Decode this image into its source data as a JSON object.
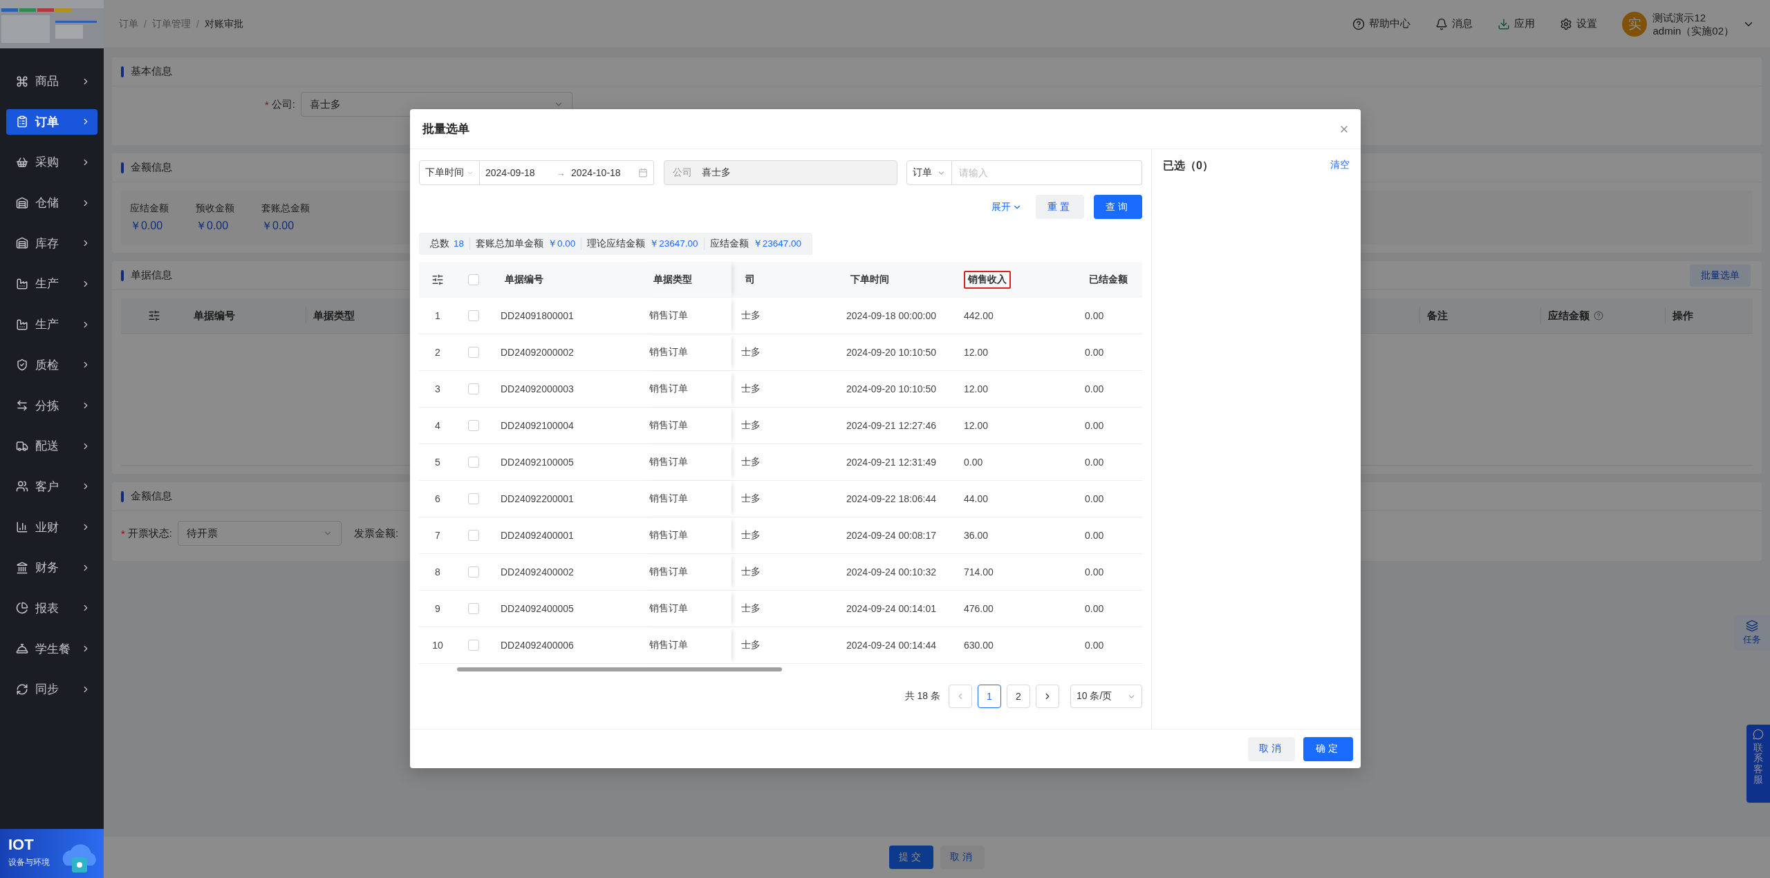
{
  "sidebar": {
    "items": [
      {
        "label": "商品",
        "selected": false
      },
      {
        "label": "订单",
        "selected": true
      },
      {
        "label": "采购",
        "selected": false
      },
      {
        "label": "仓储",
        "selected": false
      },
      {
        "label": "库存",
        "selected": false
      },
      {
        "label": "生产",
        "selected": false
      },
      {
        "label": "生产",
        "selected": false
      },
      {
        "label": "质检",
        "selected": false
      },
      {
        "label": "分拣",
        "selected": false
      },
      {
        "label": "配送",
        "selected": false
      },
      {
        "label": "客户",
        "selected": false
      },
      {
        "label": "业财",
        "selected": false
      },
      {
        "label": "财务",
        "selected": false
      },
      {
        "label": "报表",
        "selected": false
      },
      {
        "label": "学生餐",
        "selected": false
      },
      {
        "label": "同步",
        "selected": false
      }
    ],
    "banner": {
      "title": "IOT",
      "subtitle": "设备与环境"
    }
  },
  "header": {
    "breadcrumb": [
      "订单",
      "订单管理",
      "对账审批"
    ],
    "separator": "/",
    "actions": [
      "帮助中心",
      "消息",
      "应用",
      "设置"
    ],
    "user": {
      "avatar": "实",
      "name": "测试演示12",
      "role": "admin（实施02）"
    }
  },
  "page": {
    "basic": {
      "title": "基本信息",
      "field": {
        "mark": "*",
        "label": "公司:",
        "value": "喜士多"
      }
    },
    "amounts": {
      "title": "金额信息",
      "items": [
        {
          "label": "应结金额",
          "value": "￥0.00"
        },
        {
          "label": "预收金额",
          "value": "￥0.00"
        },
        {
          "label": "套账总金额",
          "value": "￥0.00"
        }
      ]
    },
    "documents": {
      "title": "单据信息",
      "batch_button": "批量选单",
      "columns": [
        {
          "label": "单据编号",
          "info": false
        },
        {
          "label": "单据类型",
          "info": false
        },
        {
          "label": "备注",
          "info": false
        },
        {
          "label": "应结金额",
          "info": true
        },
        {
          "label": "操作",
          "info": false
        }
      ]
    },
    "invoice": {
      "title": "金额信息",
      "field": {
        "mark": "*",
        "label": "开票状态:",
        "value": "待开票"
      },
      "amount_label": "发票金额:"
    },
    "footer_buttons": [
      {
        "label": "提交",
        "kind": "primary"
      },
      {
        "label": "取消",
        "kind": "secondary"
      }
    ]
  },
  "floating": {
    "tasks": "任务",
    "support": "联系客服"
  },
  "modal": {
    "title": "批量选单",
    "filters": {
      "date_field": "下单时间",
      "date_start": "2024-09-18",
      "date_sep": "→",
      "date_end": "2024-10-18",
      "company_label": "公司",
      "company_value": "喜士多",
      "search_type": "订单",
      "search_placeholder": "请输入",
      "expand": "展开",
      "reset": "重置",
      "query": "查询"
    },
    "summary": [
      {
        "label": "总数",
        "value": "18"
      },
      {
        "label": "套账总加单金额",
        "value": "￥0.00"
      },
      {
        "label": "理论应结金额",
        "value": "￥23647.00"
      },
      {
        "label": "应结金额",
        "value": "￥23647.00"
      }
    ],
    "table": {
      "all_checked": false,
      "columns": [
        {
          "label": "单据编号",
          "highlighted": false
        },
        {
          "label": "单据类型",
          "highlighted": false
        },
        {
          "label": "司",
          "highlighted": false
        },
        {
          "label": "下单时间",
          "highlighted": false
        },
        {
          "label": "销售收入",
          "highlighted": true
        },
        {
          "label": "已结金额",
          "highlighted": false
        }
      ],
      "rows": [
        {
          "index": "1",
          "checked": false,
          "number": "DD24091800001",
          "type": "销售订单",
          "company": "士多",
          "time": "2024-09-18 00:00:00",
          "revenue": "442.00",
          "settled": "0.00"
        },
        {
          "index": "2",
          "checked": false,
          "number": "DD24092000002",
          "type": "销售订单",
          "company": "士多",
          "time": "2024-09-20 10:10:50",
          "revenue": "12.00",
          "settled": "0.00"
        },
        {
          "index": "3",
          "checked": false,
          "number": "DD24092000003",
          "type": "销售订单",
          "company": "士多",
          "time": "2024-09-20 10:10:50",
          "revenue": "12.00",
          "settled": "0.00"
        },
        {
          "index": "4",
          "checked": false,
          "number": "DD24092100004",
          "type": "销售订单",
          "company": "士多",
          "time": "2024-09-21 12:27:46",
          "revenue": "12.00",
          "settled": "0.00"
        },
        {
          "index": "5",
          "checked": false,
          "number": "DD24092100005",
          "type": "销售订单",
          "company": "士多",
          "time": "2024-09-21 12:31:49",
          "revenue": "0.00",
          "settled": "0.00"
        },
        {
          "index": "6",
          "checked": false,
          "number": "DD24092200001",
          "type": "销售订单",
          "company": "士多",
          "time": "2024-09-22 18:06:44",
          "revenue": "44.00",
          "settled": "0.00"
        },
        {
          "index": "7",
          "checked": false,
          "number": "DD24092400001",
          "type": "销售订单",
          "company": "士多",
          "time": "2024-09-24 00:08:17",
          "revenue": "36.00",
          "settled": "0.00"
        },
        {
          "index": "8",
          "checked": false,
          "number": "DD24092400002",
          "type": "销售订单",
          "company": "士多",
          "time": "2024-09-24 00:10:32",
          "revenue": "714.00",
          "settled": "0.00"
        },
        {
          "index": "9",
          "checked": false,
          "number": "DD24092400005",
          "type": "销售订单",
          "company": "士多",
          "time": "2024-09-24 00:14:01",
          "revenue": "476.00",
          "settled": "0.00"
        },
        {
          "index": "10",
          "checked": false,
          "number": "DD24092400006",
          "type": "销售订单",
          "company": "士多",
          "time": "2024-09-24 00:14:44",
          "revenue": "630.00",
          "settled": "0.00"
        }
      ]
    },
    "pagination": {
      "total": "共 18 条",
      "pages": [
        {
          "label": "1",
          "selected": true
        },
        {
          "label": "2",
          "selected": false
        }
      ],
      "page_size": "10 条/页"
    },
    "selected_panel": {
      "title": "已选（0）",
      "clear": "清空"
    },
    "buttons": [
      {
        "label": "取消",
        "kind": "secondary"
      },
      {
        "label": "确定",
        "kind": "primary"
      }
    ]
  }
}
